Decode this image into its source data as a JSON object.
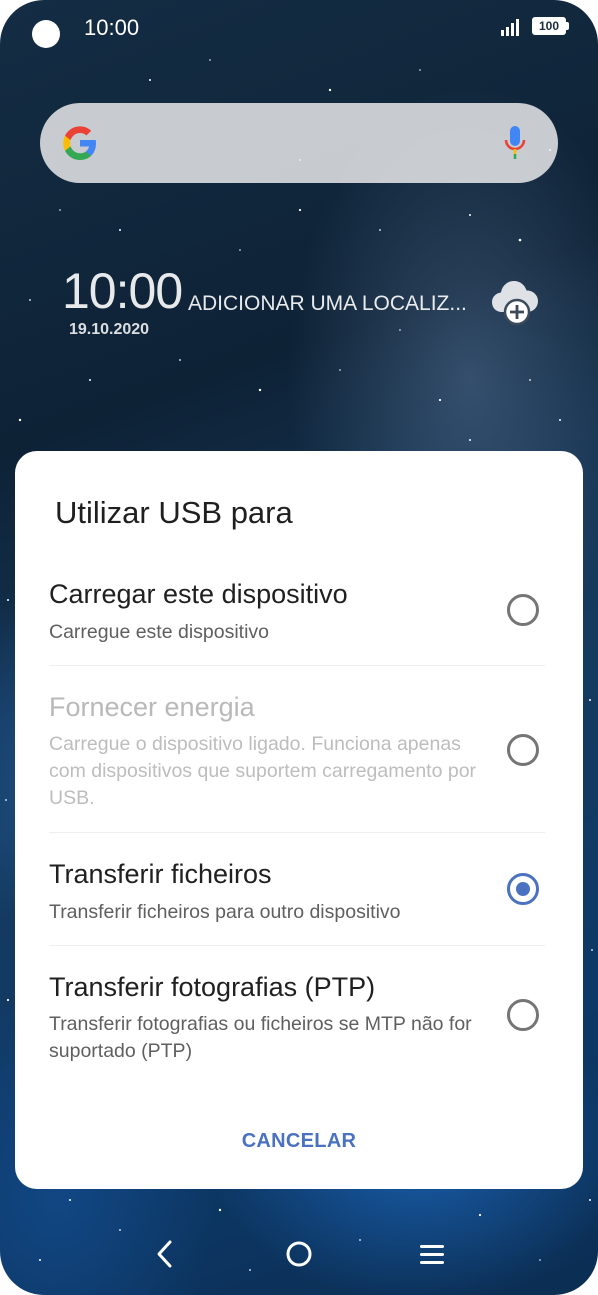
{
  "status_bar": {
    "time": "10:00",
    "battery": "100"
  },
  "icons": {
    "camera": "camera-cutout-icon",
    "signal": "signal-strength-icon",
    "battery": "battery-icon",
    "google": "google-logo-icon",
    "mic": "microphone-icon",
    "weather_add": "cloud-add-icon",
    "back": "back-icon",
    "home": "home-icon",
    "menu": "menu-icon"
  },
  "clock_widget": {
    "time": "10:00",
    "location": "ADICIONAR UMA LOCALIZ...",
    "date": "19.10.2020"
  },
  "dialog": {
    "title": "Utilizar USB para",
    "options": [
      {
        "title": "Carregar este dispositivo",
        "description": "Carregue este dispositivo",
        "selected": false,
        "enabled": true
      },
      {
        "title": "Fornecer energia",
        "description": "Carregue o dispositivo ligado. Funciona apenas com dispositivos que suportem carregamento por USB.",
        "selected": false,
        "enabled": false
      },
      {
        "title": "Transferir ficheiros",
        "description": "Transferir ficheiros para outro dispositivo",
        "selected": true,
        "enabled": true
      },
      {
        "title": "Transferir fotografias (PTP)",
        "description": "Transferir fotografias ou ficheiros se MTP não for suportado (PTP)",
        "selected": false,
        "enabled": true
      }
    ],
    "cancel_label": "CANCELAR"
  },
  "colors": {
    "accent": "#4a72c0",
    "dialog_background": "#ffffff",
    "wallpaper_dark": "#0e2236",
    "wallpaper_blue": "#0d3968"
  }
}
